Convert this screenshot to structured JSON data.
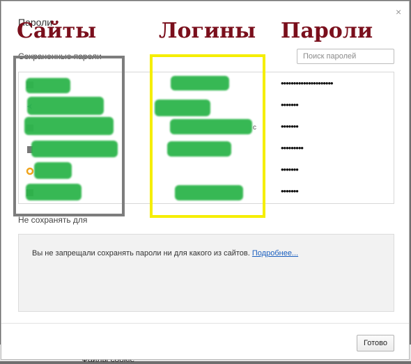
{
  "background": {
    "peek_text": "Файлы cookie"
  },
  "dialog": {
    "title": "Пароли",
    "close_glyph": "×",
    "saved_section_label": "Сохраненные пароли",
    "search_placeholder": "Поиск паролей",
    "never_saved_section_label": "Не сохранять для",
    "never_saved_text": "Вы не запрещали сохранять пароли ни для какого из сайтов.",
    "learn_more_link": "Подробнее...",
    "done_button": "Готово"
  },
  "annotations": {
    "sites_label": "Сайты",
    "logins_label": "Логины",
    "passwords_label": "Пароли",
    "label_color": "#7a0f1c",
    "sites_frame_color": "#7d7d7d",
    "logins_frame_color": "#f5ee00"
  },
  "saved_passwords": [
    {
      "password": "•••••••••••••••••••••",
      "icon": "generic-site-icon",
      "login_suffix": ""
    },
    {
      "password": "•••••••",
      "icon": "arrow-favicon-icon",
      "login_suffix": ""
    },
    {
      "password": "•••••••",
      "icon": "generic-site-icon",
      "login_suffix": "c"
    },
    {
      "password": "•••••••••",
      "icon": "document-favicon-icon",
      "login_suffix": ""
    },
    {
      "password": "•••••••",
      "icon": "orange-ring-favicon-icon",
      "login_suffix": ""
    },
    {
      "password": "•••••••",
      "icon": "generic-site-icon",
      "login_suffix": ""
    }
  ],
  "colors": {
    "mask_green": "#2db54b",
    "link_blue": "#1a5fbf"
  }
}
